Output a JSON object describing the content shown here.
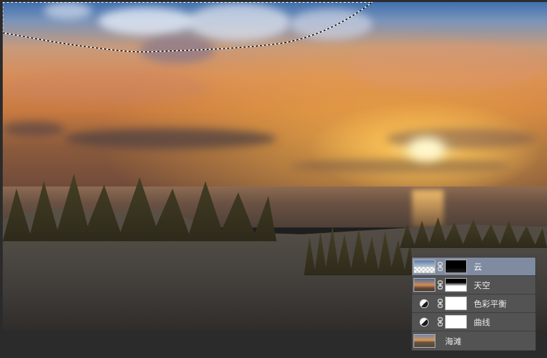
{
  "canvas": {
    "description_icon": "photo-canvas"
  },
  "layers": [
    {
      "name": "云",
      "type": "image-with-mask",
      "active": true
    },
    {
      "name": "天空",
      "type": "image-with-mask",
      "active": false
    },
    {
      "name": "色彩平衡",
      "type": "adjustment-with-mask",
      "active": false
    },
    {
      "name": "曲线",
      "type": "adjustment-with-mask",
      "active": false
    },
    {
      "name": "海滩",
      "type": "image",
      "active": false
    }
  ],
  "colors": {
    "panel_bg": "#535353",
    "active_row": "#7f8ba0",
    "app_bg": "#2b2b2b"
  }
}
